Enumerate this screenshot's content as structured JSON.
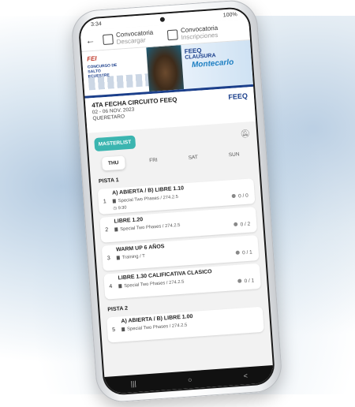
{
  "status": {
    "time": "3:34",
    "battery": "100%"
  },
  "topbar": {
    "back_icon": "arrow-left-icon",
    "convocatoria_label": "Convocatoria",
    "convocatoria_action": "Descargar",
    "inscripciones_label": "Convocatoria",
    "inscripciones_action": "Inscripciones"
  },
  "banner": {
    "fei": "FEI",
    "concurso": "CONCURSO DE SALTO ECUESTRE",
    "feeq": "FEEQ",
    "clausura": "CLAUSURA",
    "montecarlo": "Montecarlo"
  },
  "event": {
    "title": "4TA FECHA CIRCUITO FEEQ",
    "dates": "02 - 06 NOV. 2023",
    "place": "QUERETARO",
    "logo": "FEEQ"
  },
  "masterlist_label": "MASTERLIST",
  "days": [
    {
      "label": "THU",
      "active": true
    },
    {
      "label": "FRI",
      "active": false
    },
    {
      "label": "SAT",
      "active": false
    },
    {
      "label": "SUN",
      "active": false
    }
  ],
  "pistas": [
    {
      "name": "PISTA 1",
      "classes": [
        {
          "num": "1",
          "title": "A) ABIERTA / B) LIBRE 1.10",
          "sub": "Special Two Phases / 274.2.5",
          "time": "9:30",
          "count": "0 / 0"
        },
        {
          "num": "2",
          "title": "LIBRE 1.20",
          "sub": "Special Two Phases / 274.2.5",
          "time": "",
          "count": "0 / 2"
        },
        {
          "num": "3",
          "title": "WARM UP 6 AÑOS",
          "sub": "Training / T",
          "time": "",
          "count": "0 / 1"
        },
        {
          "num": "4",
          "title": "LIBRE 1.30 CALIFICATIVA CLASICO",
          "sub": "Special Two Phases / 274.2.5",
          "time": "",
          "count": "0 / 1"
        }
      ]
    },
    {
      "name": "PISTA 2",
      "classes": [
        {
          "num": "5",
          "title": "A) ABIERTA / B) LIBRE 1.00",
          "sub": "Special Two Phases / 274.2.5",
          "time": "",
          "count": ""
        }
      ]
    }
  ],
  "navbar": {
    "recent": "|||",
    "home": "○",
    "back": "<"
  }
}
